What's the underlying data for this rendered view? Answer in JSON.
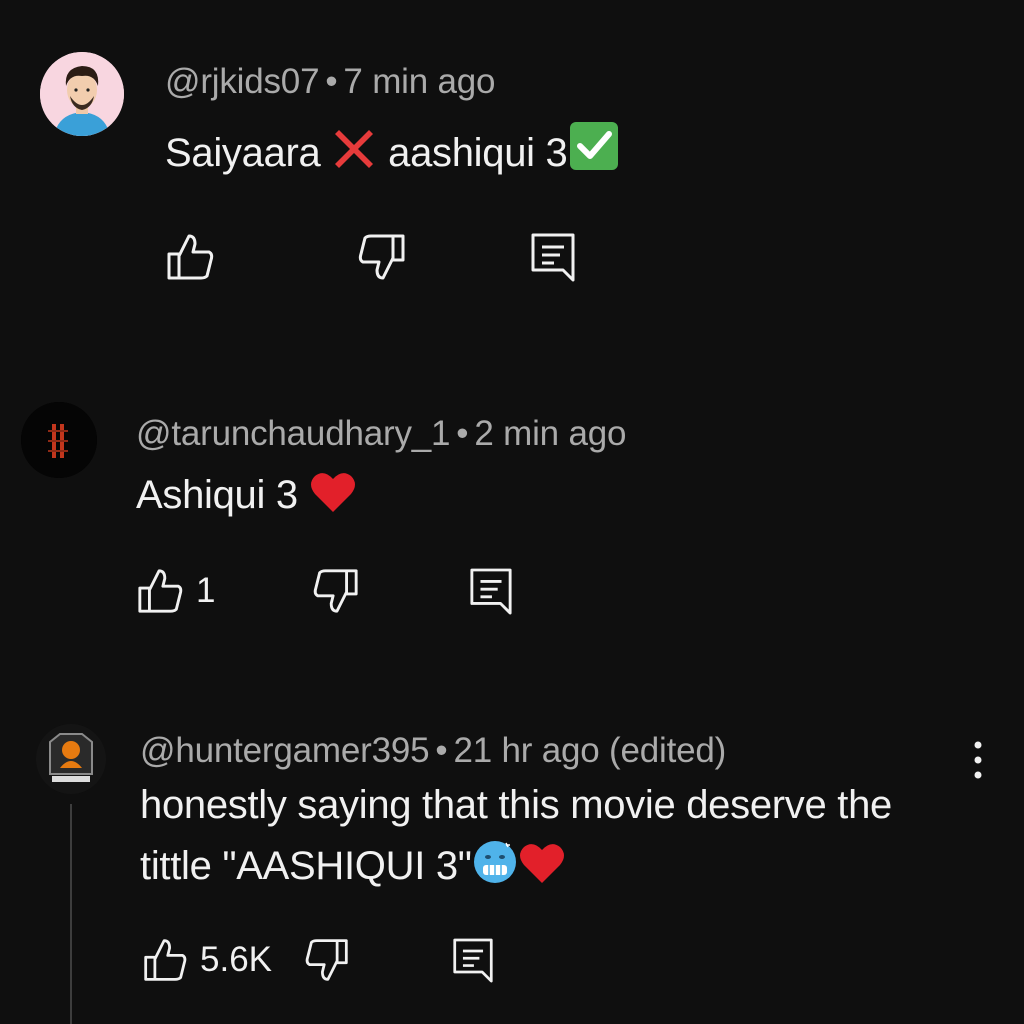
{
  "comments": [
    {
      "handle": "@rjkids07",
      "time": "7 min ago",
      "text_a": "Saiyaara",
      "text_b": "aashiqui 3",
      "emojis": [
        "cross-mark",
        "check-mark-button"
      ],
      "likes": ""
    },
    {
      "handle": "@tarunchaudhary_1",
      "time": "2 min ago",
      "text_a": "Ashiqui 3",
      "emojis": [
        "red-heart"
      ],
      "likes": "1"
    },
    {
      "handle": "@huntergamer395",
      "time": "21 hr ago (edited)",
      "line1": "honestly saying that this movie deserve the",
      "line2": "tittle \"AASHIQUI 3\"",
      "emojis": [
        "cold-face",
        "red-heart"
      ],
      "likes": "5.6K"
    }
  ],
  "separator": "•",
  "colors": {
    "background": "#0f0f0f",
    "primary_text": "#f1f1f1",
    "secondary_text": "#aaaaaa",
    "cross": "#e63b3b",
    "check": "#4caf50",
    "heart": "#e2202a"
  }
}
